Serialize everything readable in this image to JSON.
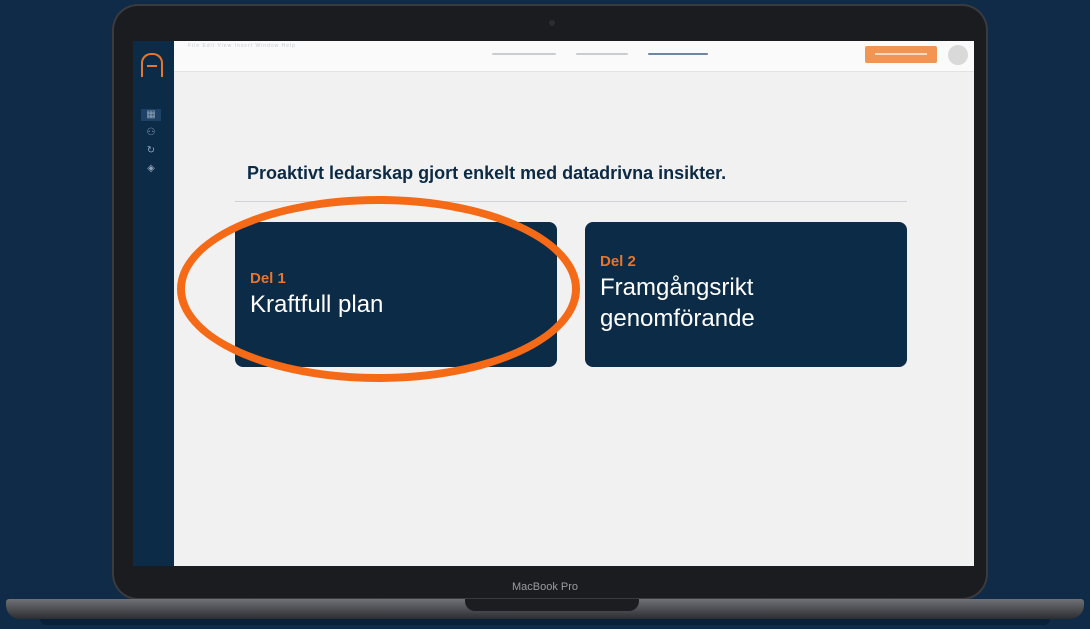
{
  "device": {
    "label": "MacBook Pro"
  },
  "app": {
    "menu_items": [
      "File",
      "Edit",
      "View",
      "Insert",
      "Window",
      "Help"
    ],
    "sidebar_icons": [
      "grid-icon",
      "users-icon",
      "refresh-icon",
      "layers-icon"
    ],
    "headline": "Proaktivt ledarskap gjort enkelt med datadrivna insikter.",
    "cards": [
      {
        "eyebrow": "Del 1",
        "title": "Kraftfull plan"
      },
      {
        "eyebrow": "Del 2",
        "title": "Framgångsrikt genomförande"
      }
    ]
  },
  "colors": {
    "background": "#0f2b48",
    "card": "#0c2b47",
    "accent": "#e8752c",
    "highlight_ring": "#f56a17"
  }
}
